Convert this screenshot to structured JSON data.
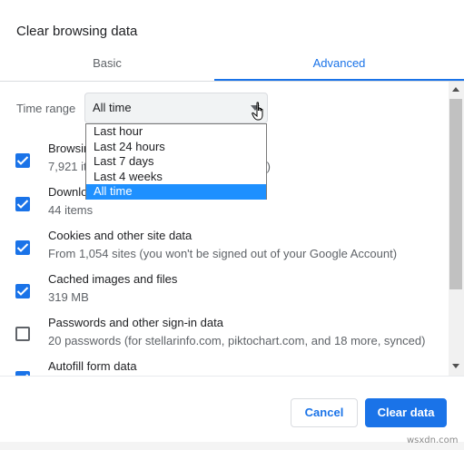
{
  "dialog": {
    "title": "Clear browsing data",
    "tabs": [
      {
        "label": "Basic",
        "active": false
      },
      {
        "label": "Advanced",
        "active": true
      }
    ]
  },
  "time_range": {
    "label": "Time range",
    "selected": "All time",
    "options": [
      "Last hour",
      "Last 24 hours",
      "Last 7 days",
      "Last 4 weeks",
      "All time"
    ]
  },
  "items": [
    {
      "title": "Browsing history",
      "subtitle": "7,921 items (and more on synced devices)",
      "checked": true
    },
    {
      "title": "Download history",
      "subtitle": "44 items",
      "checked": true
    },
    {
      "title": "Cookies and other site data",
      "subtitle": "From 1,054 sites (you won't be signed out of your Google Account)",
      "checked": true
    },
    {
      "title": "Cached images and files",
      "subtitle": "319 MB",
      "checked": true
    },
    {
      "title": "Passwords and other sign-in data",
      "subtitle": "20 passwords (for stellarinfo.com, piktochart.com, and 18 more, synced)",
      "checked": false
    },
    {
      "title": "Autofill form data",
      "subtitle": "",
      "checked": true
    }
  ],
  "buttons": {
    "cancel": "Cancel",
    "clear": "Clear data"
  },
  "watermark": "wsxdn.com",
  "colors": {
    "accent": "#1a73e8",
    "dropdown_highlight": "#1e90ff"
  }
}
